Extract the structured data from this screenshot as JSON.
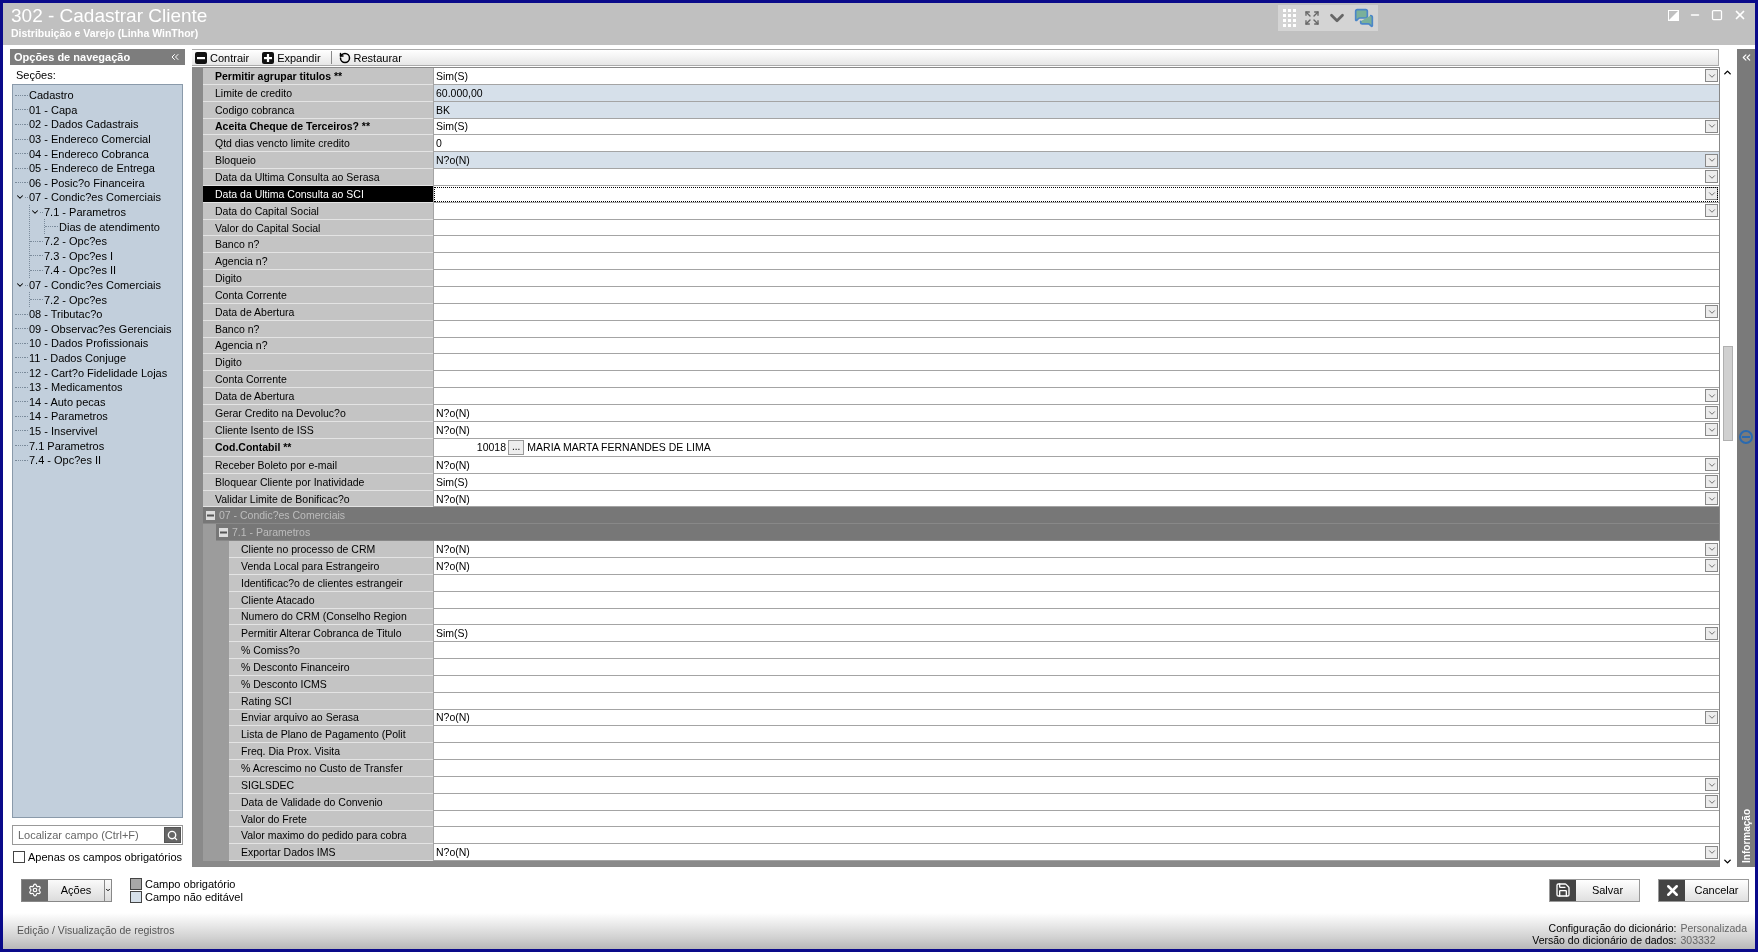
{
  "window": {
    "title": "302 - Cadastrar Cliente",
    "subtitle": "Distribuição e Varejo (Linha WinThor)"
  },
  "sidebar": {
    "title": "Opções de navegação",
    "sections_label": "Seções:",
    "tree": [
      {
        "label": "Cadastro"
      },
      {
        "label": "01 - Capa"
      },
      {
        "label": "02 - Dados Cadastrais"
      },
      {
        "label": "03 - Endereco Comercial"
      },
      {
        "label": "04 - Endereco Cobranca"
      },
      {
        "label": "05 - Endereco de Entrega"
      },
      {
        "label": "06 - Posic?o Financeira"
      },
      {
        "label": "07 - Condic?es Comerciais",
        "expanded": true,
        "children": [
          {
            "label": "7.1 - Parametros",
            "expanded": true,
            "children": [
              {
                "label": "Dias de atendimento"
              }
            ]
          },
          {
            "label": "7.2 - Opc?es"
          },
          {
            "label": "7.3 - Opc?es I"
          },
          {
            "label": "7.4 - Opc?es II"
          }
        ]
      },
      {
        "label": "07 - Condic?es Comerciais",
        "expanded": true,
        "children": [
          {
            "label": "7.2 - Opc?es"
          }
        ]
      },
      {
        "label": "08 - Tributac?o"
      },
      {
        "label": "09 - Observac?es Gerenciais"
      },
      {
        "label": "10 - Dados Profissionais"
      },
      {
        "label": "11 - Dados Conjuge"
      },
      {
        "label": "12 - Cart?o Fidelidade Lojas"
      },
      {
        "label": "13 - Medicamentos"
      },
      {
        "label": "14 - Auto pecas"
      },
      {
        "label": "14 - Parametros"
      },
      {
        "label": "15 - Inservivel"
      },
      {
        "label": "7.1 Parametros"
      },
      {
        "label": "7.4 - Opc?es II"
      }
    ],
    "search": {
      "placeholder": "Localizar campo (Ctrl+F)"
    },
    "only_required": {
      "label": "Apenas os campos obrigatórios",
      "checked": false
    }
  },
  "toolbar": [
    {
      "label": "Contrair",
      "kind": "collapse"
    },
    {
      "label": "Expandir",
      "kind": "expand"
    },
    {
      "label": "Restaurar",
      "kind": "restore"
    }
  ],
  "grid": {
    "rows": [
      {
        "kind": "field",
        "label": "Permitir agrupar titulos **",
        "value": "Sim(S)",
        "required": true,
        "editable": true,
        "dropdown": true,
        "selected": false
      },
      {
        "kind": "field",
        "label": "Limite de credito",
        "value": "60.000,00",
        "required": false,
        "editable": false,
        "dropdown": false,
        "selected": false
      },
      {
        "kind": "field",
        "label": "Codigo cobranca",
        "value": "BK",
        "required": false,
        "editable": false,
        "dropdown": false,
        "selected": false
      },
      {
        "kind": "field",
        "label": "Aceita Cheque de Terceiros? **",
        "value": "Sim(S)",
        "required": true,
        "editable": true,
        "dropdown": true,
        "selected": false
      },
      {
        "kind": "field",
        "label": "Qtd dias vencto limite credito",
        "value": "0",
        "required": false,
        "editable": true,
        "dropdown": false,
        "selected": false
      },
      {
        "kind": "field",
        "label": "Bloqueio",
        "value": "N?o(N)",
        "required": false,
        "editable": false,
        "dropdown": true,
        "selected": false
      },
      {
        "kind": "field",
        "label": "Data da Ultima Consulta ao Serasa",
        "required": false,
        "editable": true,
        "dropdown": true,
        "selected": false
      },
      {
        "kind": "field",
        "label": "Data da Ultima Consulta ao SCI",
        "required": false,
        "editable": true,
        "dropdown": true,
        "selected": true
      },
      {
        "kind": "field",
        "label": "Data do Capital Social",
        "required": false,
        "editable": true,
        "dropdown": true,
        "selected": false
      },
      {
        "kind": "field",
        "label": "Valor do Capital Social",
        "required": false,
        "editable": true,
        "dropdown": false,
        "selected": false
      },
      {
        "kind": "field",
        "label": "Banco n?",
        "required": false,
        "editable": true,
        "dropdown": false,
        "selected": false
      },
      {
        "kind": "field",
        "label": "Agencia n?",
        "required": false,
        "editable": true,
        "dropdown": false,
        "selected": false
      },
      {
        "kind": "field",
        "label": "Digito",
        "required": false,
        "editable": true,
        "dropdown": false,
        "selected": false
      },
      {
        "kind": "field",
        "label": "Conta Corrente",
        "required": false,
        "editable": true,
        "dropdown": false,
        "selected": false
      },
      {
        "kind": "field",
        "label": "Data de Abertura",
        "required": false,
        "editable": true,
        "dropdown": true,
        "selected": false
      },
      {
        "kind": "field",
        "label": "Banco n?",
        "required": false,
        "editable": true,
        "dropdown": false,
        "selected": false
      },
      {
        "kind": "field",
        "label": "Agencia n?",
        "required": false,
        "editable": true,
        "dropdown": false,
        "selected": false
      },
      {
        "kind": "field",
        "label": "Digito",
        "required": false,
        "editable": true,
        "dropdown": false,
        "selected": false
      },
      {
        "kind": "field",
        "label": "Conta Corrente",
        "required": false,
        "editable": true,
        "dropdown": false,
        "selected": false
      },
      {
        "kind": "field",
        "label": "Data de Abertura",
        "required": false,
        "editable": true,
        "dropdown": true,
        "selected": false
      },
      {
        "kind": "field",
        "label": "Gerar Credito na Devoluc?o",
        "value": "N?o(N)",
        "required": false,
        "editable": true,
        "dropdown": true,
        "selected": false
      },
      {
        "kind": "field",
        "label": "Cliente Isento de ISS",
        "value": "N?o(N)",
        "required": false,
        "editable": true,
        "dropdown": true,
        "selected": false
      },
      {
        "kind": "lookup",
        "label": "Cod.Contabil  **",
        "code": "10018",
        "button": "...",
        "value": "MARIA MARTA FERNANDES DE LIMA",
        "required": true,
        "editable": true,
        "dropdown": false,
        "selected": false
      },
      {
        "kind": "field",
        "label": "Receber Boleto por e-mail",
        "value": "N?o(N)",
        "required": false,
        "editable": true,
        "dropdown": true,
        "selected": false
      },
      {
        "kind": "field",
        "label": "Bloquear Cliente por Inatividade",
        "value": "Sim(S)",
        "required": false,
        "editable": true,
        "dropdown": true,
        "selected": false
      },
      {
        "kind": "field",
        "label": "Validar Limite de Bonificac?o",
        "value": "N?o(N)",
        "required": false,
        "editable": true,
        "dropdown": true,
        "selected": false
      }
    ],
    "sections": [
      {
        "title": "07 - Condic?es Comerciais",
        "expanded": true,
        "children": [
          {
            "title": "7.1 - Parametros",
            "expanded": true,
            "rows": [
              {
                "kind": "field",
                "label": "Cliente no processo de CRM",
                "value": "N?o(N)",
                "required": false,
                "editable": true,
                "dropdown": true,
                "selected": false
              },
              {
                "kind": "field",
                "label": "Venda Local para Estrangeiro",
                "value": "N?o(N)",
                "required": false,
                "editable": true,
                "dropdown": true,
                "selected": false
              },
              {
                "kind": "field",
                "label": "Identificac?o de clientes estrangeir",
                "required": false,
                "editable": true,
                "dropdown": false,
                "selected": false
              },
              {
                "kind": "field",
                "label": "Cliente Atacado",
                "required": false,
                "editable": true,
                "dropdown": false,
                "selected": false
              },
              {
                "kind": "field",
                "label": "Numero do CRM (Conselho Region",
                "required": false,
                "editable": true,
                "dropdown": false,
                "selected": false
              },
              {
                "kind": "field",
                "label": "Permitir Alterar Cobranca de Titulo",
                "value": "Sim(S)",
                "required": false,
                "editable": true,
                "dropdown": true,
                "selected": false
              },
              {
                "kind": "field",
                "label": "% Comiss?o",
                "required": false,
                "editable": true,
                "dropdown": false,
                "selected": false
              },
              {
                "kind": "field",
                "label": "% Desconto Financeiro",
                "required": false,
                "editable": true,
                "dropdown": false,
                "selected": false
              },
              {
                "kind": "field",
                "label": "% Desconto ICMS",
                "required": false,
                "editable": true,
                "dropdown": false,
                "selected": false
              },
              {
                "kind": "field",
                "label": "Rating SCI",
                "required": false,
                "editable": true,
                "dropdown": false,
                "selected": false
              },
              {
                "kind": "field",
                "label": "Enviar arquivo ao Serasa",
                "value": "N?o(N)",
                "required": false,
                "editable": true,
                "dropdown": true,
                "selected": false
              },
              {
                "kind": "field",
                "label": "Lista de Plano de Pagamento (Polit",
                "required": false,
                "editable": true,
                "dropdown": false,
                "selected": false
              },
              {
                "kind": "field",
                "label": "Freq. Dia Prox. Visita",
                "required": false,
                "editable": true,
                "dropdown": false,
                "selected": false
              },
              {
                "kind": "field",
                "label": "% Acrescimo no Custo de Transfer",
                "required": false,
                "editable": true,
                "dropdown": false,
                "selected": false
              },
              {
                "kind": "field",
                "label": "SIGLSDEC",
                "required": false,
                "editable": true,
                "dropdown": true,
                "selected": false
              },
              {
                "kind": "field",
                "label": "Data de Validade do Convenio",
                "required": false,
                "editable": true,
                "dropdown": true,
                "selected": false
              },
              {
                "kind": "field",
                "label": "Valor do Frete",
                "required": false,
                "editable": true,
                "dropdown": false,
                "selected": false
              },
              {
                "kind": "field",
                "label": "Valor maximo do pedido para cobra",
                "required": false,
                "editable": true,
                "dropdown": false,
                "selected": false
              },
              {
                "kind": "field",
                "label": "Exportar Dados IMS",
                "value": "N?o(N)",
                "required": false,
                "editable": true,
                "dropdown": true,
                "selected": false
              }
            ]
          }
        ]
      }
    ]
  },
  "actions": {
    "label": "Ações"
  },
  "legend": [
    {
      "label": "Campo obrigatório",
      "color": "#a8a8a8"
    },
    {
      "label": "Campo não editável",
      "color": "#d6e0ea"
    }
  ],
  "buttons": [
    {
      "label": "Salvar",
      "kind": "save"
    },
    {
      "label": "Cancelar",
      "kind": "cancel"
    }
  ],
  "side_panel": {
    "title": "Informação"
  },
  "status_bar": {
    "text": "Edição / Visualização de registros",
    "info": [
      {
        "label": "Configuração do dicionário:",
        "value": "Personalizada"
      },
      {
        "label": "Versão do dicionário de dados:",
        "value": "303332"
      }
    ]
  }
}
